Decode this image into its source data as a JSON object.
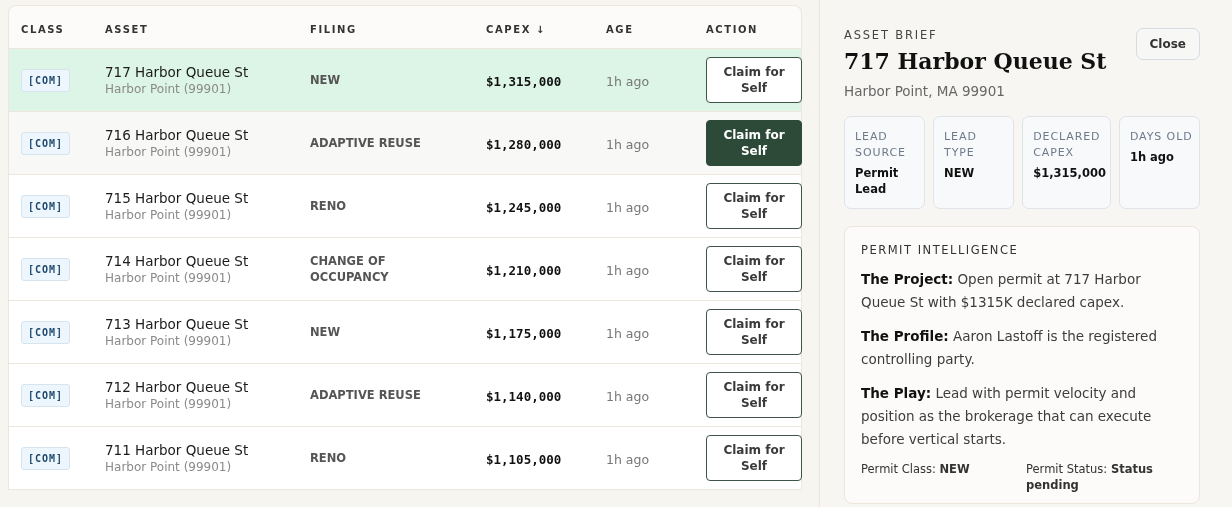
{
  "table": {
    "columns": [
      {
        "label": "CLASS"
      },
      {
        "label": "ASSET"
      },
      {
        "label": "FILING"
      },
      {
        "label": "CAPEX",
        "sort_icon": "↓"
      },
      {
        "label": "AGE"
      },
      {
        "label": "ACTION"
      }
    ],
    "rows": [
      {
        "class": "[COM]",
        "asset": "717 Harbor Queue St",
        "locality": "Harbor Point (99901)",
        "filing": "NEW",
        "capex": "$1,315,000",
        "age": "1h ago",
        "action": "Claim for Self",
        "selected": true,
        "hovered": false
      },
      {
        "class": "[COM]",
        "asset": "716 Harbor Queue St",
        "locality": "Harbor Point (99901)",
        "filing": "ADAPTIVE REUSE",
        "capex": "$1,280,000",
        "age": "1h ago",
        "action": "Claim for Self",
        "selected": false,
        "hovered": true
      },
      {
        "class": "[COM]",
        "asset": "715 Harbor Queue St",
        "locality": "Harbor Point (99901)",
        "filing": "RENO",
        "capex": "$1,245,000",
        "age": "1h ago",
        "action": "Claim for Self",
        "selected": false,
        "hovered": false
      },
      {
        "class": "[COM]",
        "asset": "714 Harbor Queue St",
        "locality": "Harbor Point (99901)",
        "filing": "CHANGE OF OCCUPANCY",
        "capex": "$1,210,000",
        "age": "1h ago",
        "action": "Claim for Self",
        "selected": false,
        "hovered": false
      },
      {
        "class": "[COM]",
        "asset": "713 Harbor Queue St",
        "locality": "Harbor Point (99901)",
        "filing": "NEW",
        "capex": "$1,175,000",
        "age": "1h ago",
        "action": "Claim for Self",
        "selected": false,
        "hovered": false
      },
      {
        "class": "[COM]",
        "asset": "712 Harbor Queue St",
        "locality": "Harbor Point (99901)",
        "filing": "ADAPTIVE REUSE",
        "capex": "$1,140,000",
        "age": "1h ago",
        "action": "Claim for Self",
        "selected": false,
        "hovered": false
      },
      {
        "class": "[COM]",
        "asset": "711 Harbor Queue St",
        "locality": "Harbor Point (99901)",
        "filing": "RENO",
        "capex": "$1,105,000",
        "age": "1h ago",
        "action": "Claim for Self",
        "selected": false,
        "hovered": false
      }
    ]
  },
  "brief": {
    "eyebrow": "ASSET BRIEF",
    "title": "717 Harbor Queue St",
    "subtitle": "Harbor Point, MA 99901",
    "close": "Close",
    "stats": [
      {
        "label": "LEAD SOURCE",
        "value": "Permit Lead"
      },
      {
        "label": "LEAD TYPE",
        "value": "NEW"
      },
      {
        "label": "DECLARED CAPEX",
        "value": "$1,315,000"
      },
      {
        "label": "DAYS OLD",
        "value": "1h ago"
      }
    ],
    "intel": {
      "heading": "PERMIT INTELLIGENCE",
      "paragraphs": [
        "**The Project:** Open permit at 717 Harbor Queue St with $1315K declared capex.",
        "**The Profile:** Aaron Lastoff is the registered controlling party.",
        "**The Play:** Lead with permit velocity and position as the brokerage that can execute before vertical starts."
      ],
      "facts": [
        "Permit Class: **NEW**",
        "Permit Status: **Status pending**"
      ]
    }
  }
}
